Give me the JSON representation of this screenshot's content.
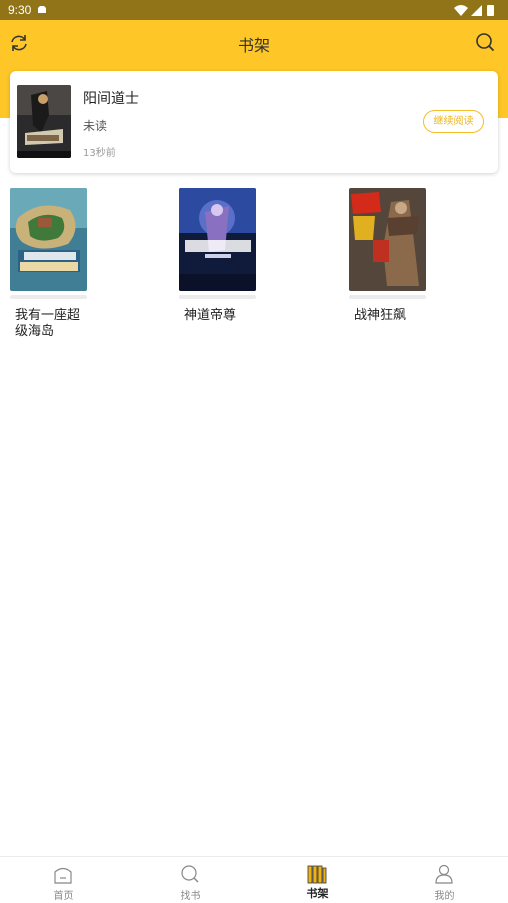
{
  "status_bar": {
    "time": "9:30"
  },
  "header": {
    "title": "书架"
  },
  "recent": {
    "title": "阳间道士",
    "status": "未读",
    "time_ago": "13秒前",
    "continue_label": "继续阅读"
  },
  "books": [
    {
      "title": "我有一座超级海岛"
    },
    {
      "title": "神道帝尊"
    },
    {
      "title": "战神狂飙"
    }
  ],
  "nav": {
    "items": [
      {
        "label": "首页"
      },
      {
        "label": "找书"
      },
      {
        "label": "书架"
      },
      {
        "label": "我的"
      }
    ]
  },
  "colors": {
    "accent": "#fec626",
    "status_bar": "#927418",
    "button_text": "#f0b317"
  }
}
